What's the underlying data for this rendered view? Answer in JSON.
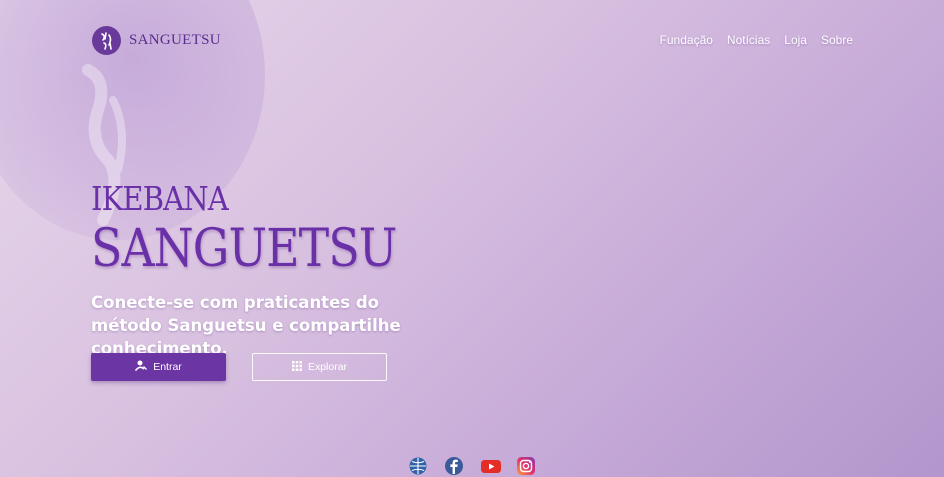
{
  "brand": {
    "name": "SANGUETSU"
  },
  "nav": {
    "items": [
      {
        "label": "Fundação"
      },
      {
        "label": "Notícias"
      },
      {
        "label": "Loja"
      },
      {
        "label": "Sobre"
      }
    ]
  },
  "hero": {
    "line1": "IKEBANA",
    "line2": "SANGUETSU",
    "subtitle": "Conecte-se com praticantes do método Sanguetsu e compartilhe conhecimento."
  },
  "actions": {
    "primary_label": "Entrar",
    "secondary_label": "Explorar"
  },
  "social": [
    {
      "icon": "globe-icon"
    },
    {
      "icon": "facebook-icon"
    },
    {
      "icon": "youtube-icon"
    },
    {
      "icon": "instagram-icon"
    }
  ],
  "colors": {
    "accent": "#6b35a4",
    "brand_text": "#5a2d8c"
  }
}
